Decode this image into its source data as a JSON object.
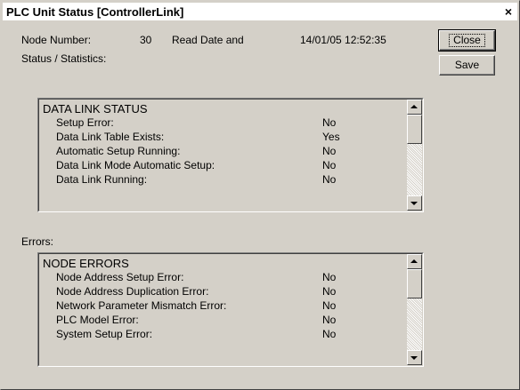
{
  "window": {
    "title": "PLC Unit Status [ControllerLink]",
    "close_glyph": "×"
  },
  "header": {
    "node_number_label": "Node Number:",
    "node_number_value": "30",
    "read_date_label": "Read Date and",
    "read_date_value": "14/01/05 12:52:35"
  },
  "buttons": {
    "close_label": "Close",
    "save_label": "Save"
  },
  "status": {
    "section_label": "Status / Statistics:",
    "list_title": "DATA LINK STATUS",
    "rows": [
      {
        "key": "Setup Error:",
        "value": "No"
      },
      {
        "key": "Data Link Table Exists:",
        "value": "Yes"
      },
      {
        "key": "Automatic Setup Running:",
        "value": "No"
      },
      {
        "key": "Data Link Mode Automatic Setup:",
        "value": "No"
      },
      {
        "key": "Data Link Running:",
        "value": "No"
      }
    ]
  },
  "errors": {
    "section_label": "Errors:",
    "list_title": "NODE ERRORS",
    "rows": [
      {
        "key": "Node Address Setup Error:",
        "value": "No"
      },
      {
        "key": "Node Address Duplication Error:",
        "value": "No"
      },
      {
        "key": "Network Parameter Mismatch Error:",
        "value": "No"
      },
      {
        "key": "PLC Model Error:",
        "value": "No"
      },
      {
        "key": "System Setup Error:",
        "value": "No"
      }
    ]
  }
}
